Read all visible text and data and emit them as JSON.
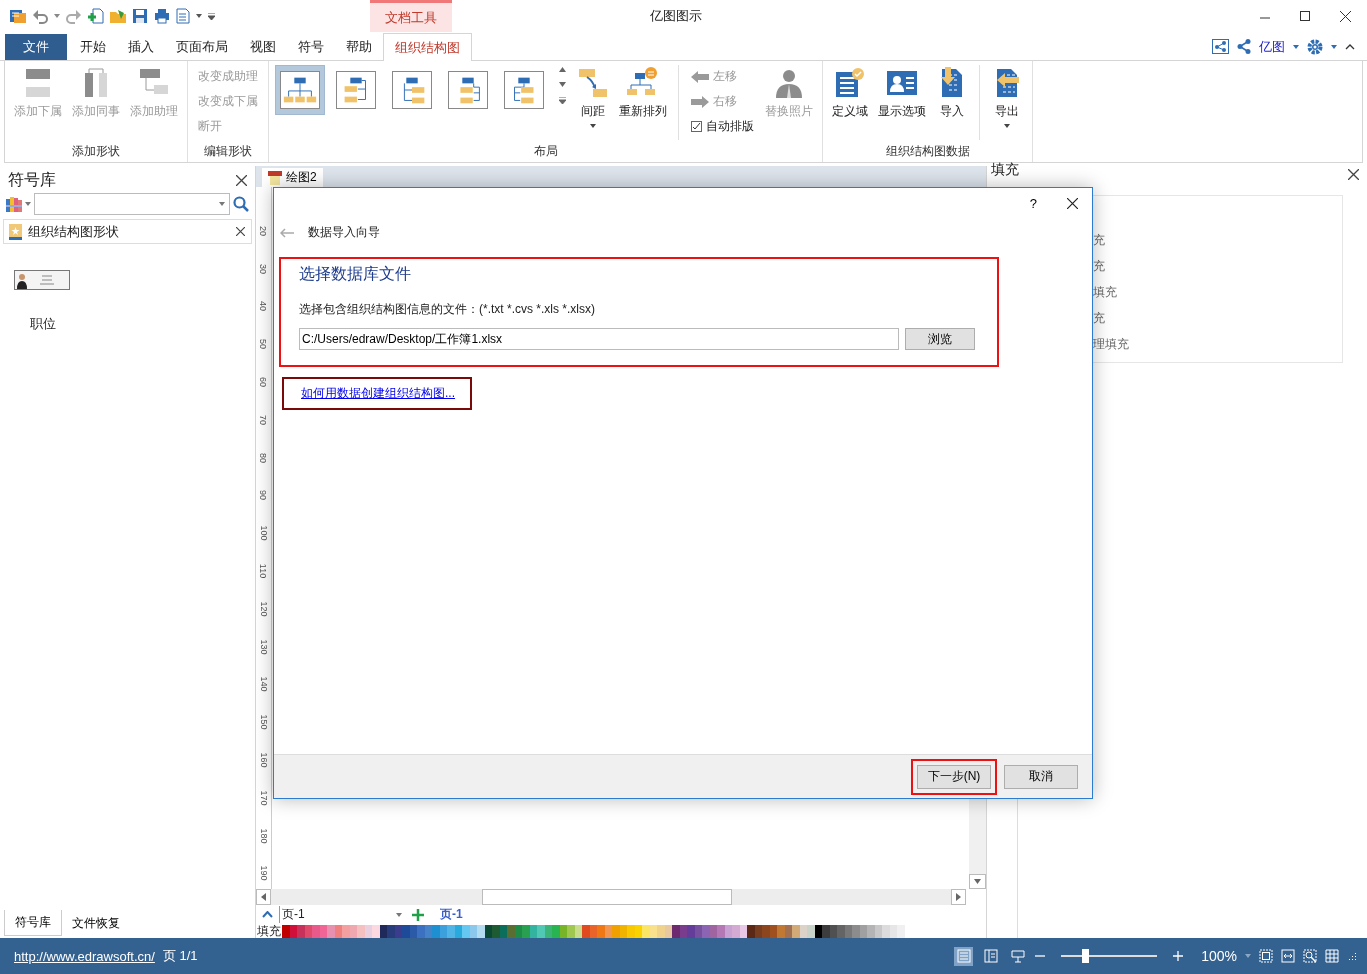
{
  "context_tab": "文档工具",
  "window": {
    "title": "亿图图示"
  },
  "tabs": [
    {
      "label": "文件",
      "kind": "file",
      "selected": false
    },
    {
      "label": "开始",
      "kind": "tab",
      "selected": false
    },
    {
      "label": "插入",
      "kind": "tab",
      "selected": false
    },
    {
      "label": "页面布局",
      "kind": "tab",
      "selected": false
    },
    {
      "label": "视图",
      "kind": "tab",
      "selected": false
    },
    {
      "label": "符号",
      "kind": "tab",
      "selected": false
    },
    {
      "label": "帮助",
      "kind": "tab",
      "selected": false
    },
    {
      "label": "组织结构图",
      "kind": "tab",
      "selected": true
    }
  ],
  "account": {
    "label": "亿图"
  },
  "ribbon": {
    "groups": [
      {
        "label": "添加形状",
        "items": [
          {
            "kind": "large",
            "label": "添加下属",
            "disabled": true
          },
          {
            "kind": "large",
            "label": "添加同事",
            "disabled": true
          },
          {
            "kind": "large",
            "label": "添加助理",
            "disabled": true
          }
        ]
      },
      {
        "label": "编辑形状",
        "items": [
          {
            "kind": "stack",
            "items": [
              {
                "kind": "small",
                "label": "改变成助理",
                "disabled": true
              },
              {
                "kind": "small",
                "label": "改变成下属",
                "disabled": true
              },
              {
                "kind": "small",
                "label": "断开",
                "disabled": true
              }
            ]
          }
        ]
      },
      {
        "label": "布局",
        "items": [
          {
            "kind": "layout",
            "selected": true
          },
          {
            "kind": "layout",
            "selected": false
          },
          {
            "kind": "layout",
            "selected": false
          },
          {
            "kind": "layout",
            "selected": false
          },
          {
            "kind": "layout",
            "selected": false
          },
          {
            "kind": "large",
            "label": "间距",
            "disabled": false,
            "dropdown": true
          },
          {
            "kind": "large",
            "label": "重新排列",
            "disabled": false,
            "dropdown": false
          },
          {
            "kind": "separator"
          },
          {
            "kind": "stack",
            "items": [
              {
                "kind": "arrow",
                "label": "左移",
                "disabled": true
              },
              {
                "kind": "arrow",
                "label": "右移",
                "disabled": true
              },
              {
                "kind": "check",
                "label": "自动排版",
                "checked": true
              }
            ]
          },
          {
            "kind": "large",
            "label": "替换照片",
            "disabled": true,
            "dropdown": false
          }
        ]
      },
      {
        "label": "组织结构图数据",
        "items": [
          {
            "kind": "large",
            "label": "定义域",
            "disabled": false,
            "dropdown": false
          },
          {
            "kind": "large",
            "label": "显示选项",
            "disabled": false,
            "dropdown": false
          },
          {
            "kind": "large",
            "label": "导入",
            "disabled": false,
            "dropdown": false
          },
          {
            "kind": "separator"
          },
          {
            "kind": "large",
            "label": "导出",
            "disabled": false,
            "dropdown": true
          }
        ]
      }
    ]
  },
  "symbol_panel": {
    "title": "符号库",
    "library": "组织结构图形状",
    "shapes": [
      {
        "label": "职位"
      }
    ],
    "bottom_tabs": [
      {
        "label": "符号库",
        "selected": true
      },
      {
        "label": "文件恢复",
        "selected": false
      }
    ]
  },
  "document_tab": {
    "label": "绘图2"
  },
  "ruler": {
    "labels": [
      "20",
      "30",
      "40",
      "50",
      "60",
      "70",
      "80",
      "90",
      "100",
      "110",
      "120",
      "130",
      "140",
      "150",
      "160",
      "170",
      "180",
      "190"
    ]
  },
  "dialog": {
    "help_button": "?",
    "heading": "数据导入向导",
    "section_title": "选择数据库文件",
    "section_highlighted": true,
    "prompt": "选择包含组织结构图信息的文件：(*.txt  *.cvs  *.xls  *.xlsx)",
    "path": "C:/Users/edraw/Desktop/工作簿1.xlsx",
    "browse_button": "浏览",
    "help_link": "如何用数据创建组织结构图...",
    "link_highlighted": true,
    "buttons": [
      {
        "label": "下一步(N)",
        "highlighted": true
      },
      {
        "label": "取消",
        "highlighted": false
      }
    ]
  },
  "fill_panel": {
    "title": "填充",
    "options": [
      "充",
      "充",
      "填充",
      "充",
      "理填充"
    ]
  },
  "page_bar": {
    "page_select": "页-1",
    "page_tabs": [
      {
        "label": "页-1",
        "selected": true
      }
    ]
  },
  "palette": {
    "label": "填充",
    "swatches": [
      {
        "color": "#c00000"
      },
      {
        "color": "#d0103a"
      },
      {
        "color": "#c8325a"
      },
      {
        "color": "#e04a6a"
      },
      {
        "color": "#e85a8a"
      },
      {
        "color": "#f06496"
      },
      {
        "color": "#e890b0"
      },
      {
        "color": "#f08080"
      },
      {
        "color": "#f4a0a0"
      },
      {
        "color": "#f0a8b0"
      },
      {
        "color": "#f4c0c0"
      },
      {
        "color": "#e8d0e0"
      },
      {
        "color": "#fcd8e0"
      },
      {
        "color": "#1f2a5a"
      },
      {
        "color": "#283c7c"
      },
      {
        "color": "#3c3c8c"
      },
      {
        "color": "#1e4a9a"
      },
      {
        "color": "#2a5aa8"
      },
      {
        "color": "#3c70c0"
      },
      {
        "color": "#4682c8"
      },
      {
        "color": "#1e90d2"
      },
      {
        "color": "#3ca0dc"
      },
      {
        "color": "#50b4e6"
      },
      {
        "color": "#28aadc"
      },
      {
        "color": "#64c8f0"
      },
      {
        "color": "#8cc8ec"
      },
      {
        "color": "#b4dcf0"
      },
      {
        "color": "#0a4a32"
      },
      {
        "color": "#1e5a32"
      },
      {
        "color": "#0a6e5a"
      },
      {
        "color": "#5a6e32"
      },
      {
        "color": "#1e8c46"
      },
      {
        "color": "#28a050"
      },
      {
        "color": "#32b4a0"
      },
      {
        "color": "#50c8b4"
      },
      {
        "color": "#3cb478"
      },
      {
        "color": "#28b450"
      },
      {
        "color": "#78b428"
      },
      {
        "color": "#a0c850"
      },
      {
        "color": "#c8dc8c"
      },
      {
        "color": "#e04a1e"
      },
      {
        "color": "#e86428"
      },
      {
        "color": "#f07814"
      },
      {
        "color": "#f09650"
      },
      {
        "color": "#f0a000"
      },
      {
        "color": "#f0b400"
      },
      {
        "color": "#f8c800"
      },
      {
        "color": "#fad200"
      },
      {
        "color": "#fae664"
      },
      {
        "color": "#f8e08c"
      },
      {
        "color": "#f0d28c"
      },
      {
        "color": "#e8c8a0"
      },
      {
        "color": "#6e2a6e"
      },
      {
        "color": "#7a3c8c"
      },
      {
        "color": "#643c9a"
      },
      {
        "color": "#7850a0"
      },
      {
        "color": "#8c64b4"
      },
      {
        "color": "#a064a0"
      },
      {
        "color": "#b478b4"
      },
      {
        "color": "#c8a0d2"
      },
      {
        "color": "#d2aad2"
      },
      {
        "color": "#e8c8e6"
      },
      {
        "color": "#5a2814"
      },
      {
        "color": "#783c1e"
      },
      {
        "color": "#8c461e"
      },
      {
        "color": "#a0501e"
      },
      {
        "color": "#c07832"
      },
      {
        "color": "#a07050"
      },
      {
        "color": "#d2aa78"
      },
      {
        "color": "#dcd2c8"
      },
      {
        "color": "#c8d2c8"
      },
      {
        "color": "#000000"
      },
      {
        "color": "#3c3c3c"
      },
      {
        "color": "#505050"
      },
      {
        "color": "#646464"
      },
      {
        "color": "#787878"
      },
      {
        "color": "#8c8c8c"
      },
      {
        "color": "#a0a0a0"
      },
      {
        "color": "#b4b4b4"
      },
      {
        "color": "#c8c8c8"
      },
      {
        "color": "#dcdcdc"
      },
      {
        "color": "#e6e6e6"
      },
      {
        "color": "#f0f0f0"
      }
    ]
  },
  "status_bar": {
    "url": "http://www.edrawsoft.cn/",
    "page": "页 1/1",
    "views": [
      {
        "selected": true
      },
      {
        "selected": false
      },
      {
        "selected": false
      }
    ],
    "zoom": {
      "level": 0.25,
      "reading": "100%"
    }
  }
}
